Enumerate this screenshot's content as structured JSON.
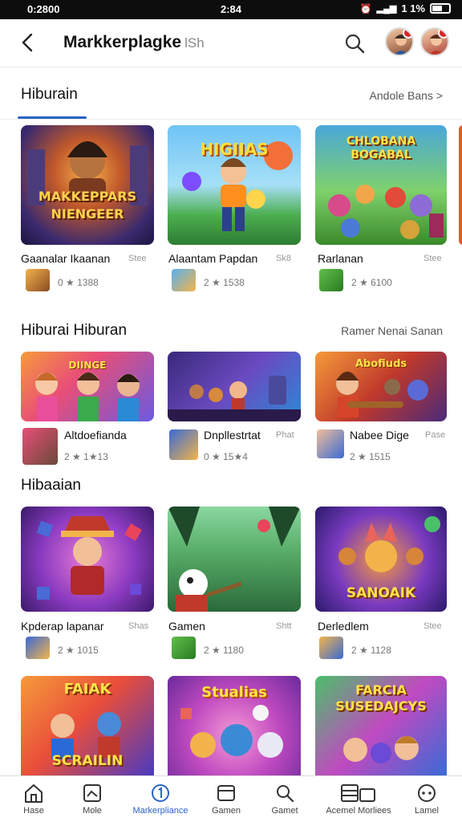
{
  "status_bar": {
    "time": "0:2800",
    "center": "2:84",
    "battery": "1 1%"
  },
  "header": {
    "title": "Markkerplagke",
    "title_suffix": "lSh",
    "back_icon": "back-arrow-icon",
    "search_icon": "search-icon"
  },
  "sections": [
    {
      "title": "Hiburain",
      "see_all": "Andole Bans >",
      "cards": [
        {
          "art_title": "MAKKEPPARS NIENGEER",
          "name": "Gaanalar Ikaanan",
          "size": "Stee",
          "rating": "0 ★ 1388"
        },
        {
          "art_title": "HIGIIAS",
          "name": "Alaantam Papdan",
          "size": "Sk8",
          "rating": "2 ★ 1538"
        },
        {
          "art_title": "CHLOBANA BOGABAL",
          "name": "Rarlanan",
          "size": "Stee",
          "rating": "2 ★ 6100"
        }
      ]
    },
    {
      "title": "Hiburai Hiburan",
      "see_all": "Ramer Nenai Sanan",
      "cards": [
        {
          "art_title": "DIINGE",
          "name": "Altdoefianda",
          "size": "",
          "rating": "2 ★ 1★13"
        },
        {
          "art_title": "",
          "name": "Dnpllestrtat",
          "size": "Phat",
          "rating": "0 ★ 15★4"
        },
        {
          "art_title": "Abofiuds",
          "name": "Nabee Dige",
          "size": "Pase",
          "rating": "2 ★ 1515"
        }
      ]
    },
    {
      "title": "Hibaaian",
      "see_all": "",
      "cards": [
        {
          "art_title": "",
          "name": "Kpderap lapanar",
          "size": "Shas",
          "rating": "2 ★ 1015"
        },
        {
          "art_title": "",
          "name": "Gamen",
          "size": "Shtt",
          "rating": "2 ★ 1180"
        },
        {
          "art_title": "SANOAIK",
          "name": "Derledlem",
          "size": "Stee",
          "rating": "2 ★ 1128"
        }
      ]
    },
    {
      "title": "",
      "see_all": "",
      "cards": [
        {
          "art_title": "FAIAK",
          "art_title_2": "SCRAILIN"
        },
        {
          "art_title": "Stualias"
        },
        {
          "art_title": "FARCIA SUSEDAJCYS"
        }
      ]
    }
  ],
  "bottom_nav": [
    {
      "label": "Hase",
      "icon": "home-icon"
    },
    {
      "label": "Mole",
      "icon": "gallery-icon"
    },
    {
      "label": "Markerpliance",
      "icon": "marketplace-icon",
      "active": true
    },
    {
      "label": "Gamen",
      "icon": "games-icon"
    },
    {
      "label": "Gamet",
      "icon": "search-icon"
    },
    {
      "label": "Acemel Morliees",
      "icon": "library-icon"
    },
    {
      "label": "Lamel",
      "icon": "settings-icon"
    }
  ],
  "colors": {
    "accent": "#2b62c8",
    "statusbar": "#0d0d0d"
  }
}
